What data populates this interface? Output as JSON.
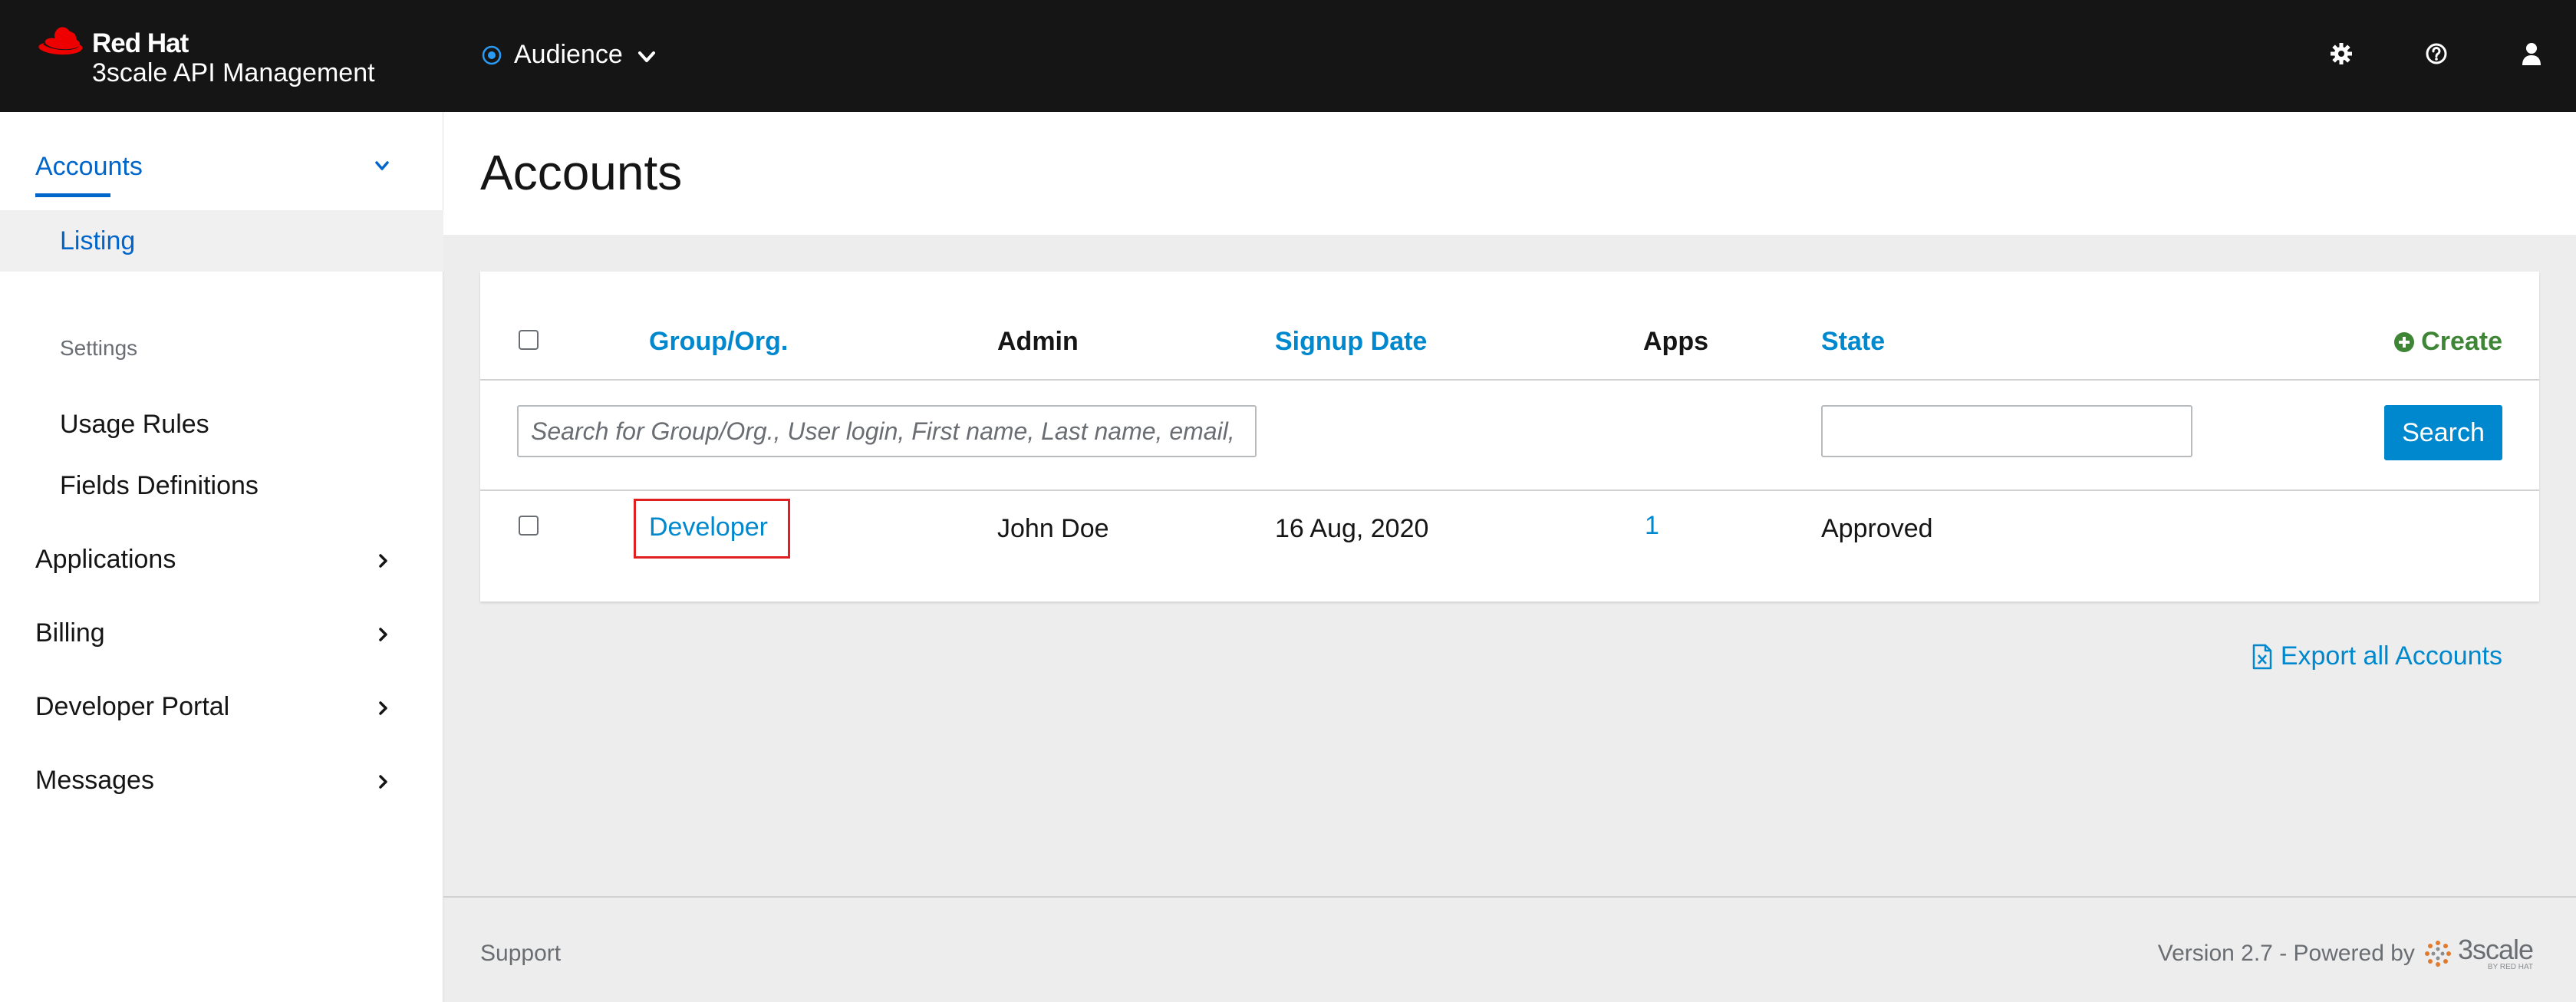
{
  "brand": {
    "line1": "Red Hat",
    "line2": "3scale API Management"
  },
  "context": {
    "label": "Audience"
  },
  "top_icons": [
    "gear-icon",
    "help-icon",
    "user-icon"
  ],
  "sidebar": {
    "accounts": "Accounts",
    "listing": "Listing",
    "settings_heading": "Settings",
    "usage_rules": "Usage Rules",
    "fields_definitions": "Fields Definitions",
    "applications": "Applications",
    "billing": "Billing",
    "developer_portal": "Developer Portal",
    "messages": "Messages"
  },
  "page": {
    "title": "Accounts"
  },
  "table": {
    "headers": {
      "group_org": "Group/Org.",
      "admin": "Admin",
      "signup_date": "Signup Date",
      "apps": "Apps",
      "state": "State"
    },
    "create_label": "Create",
    "search_placeholder": "Search for Group/Org., User login, First name, Last name, email, u",
    "search_button": "Search",
    "rows": [
      {
        "group_org": "Developer",
        "admin": "John Doe",
        "signup_date": "16 Aug, 2020",
        "apps": "1",
        "state": "Approved"
      }
    ]
  },
  "export_label": "Export all Accounts",
  "footer": {
    "support": "Support",
    "version": "Version 2.7 - Powered by",
    "logo_text": "3scale",
    "logo_sub": "BY RED HAT"
  },
  "colors": {
    "topbar": "#151515",
    "link": "#0088ce",
    "nav_active": "#0066cc",
    "create": "#3e8635",
    "highlight": "#e02020"
  }
}
